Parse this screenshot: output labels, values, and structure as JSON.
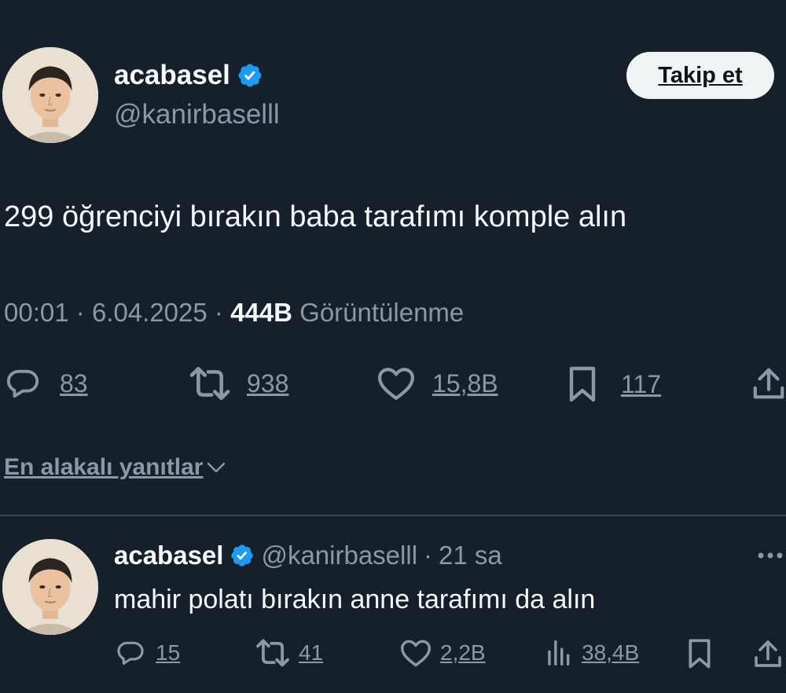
{
  "tweet": {
    "author": {
      "display_name": "acabasel",
      "handle": "@kanirbaselll",
      "verified": true,
      "avatar": "avatar-photo"
    },
    "follow_label": "Takip et",
    "text": "299 öğrenciyi bırakın baba tarafımı komple alın",
    "time": "00:01",
    "date": "6.04.2025",
    "separator": "·",
    "views_count": "444B",
    "views_label": "Görüntülenme",
    "actions": {
      "replies": "83",
      "retweets": "938",
      "likes": "15,8B",
      "bookmarks": "117"
    }
  },
  "sort": {
    "label": "En alakalı yanıtlar"
  },
  "reply": {
    "author": {
      "display_name": "acabasel",
      "handle": "@kanirbaselll",
      "verified": true
    },
    "separator": "·",
    "time": "21 sa",
    "text": "mahir polatı bırakın anne tarafımı da alın",
    "actions": {
      "replies": "15",
      "retweets": "41",
      "likes": "2,2B",
      "views": "38,4B"
    }
  },
  "colors": {
    "background": "#15202b",
    "text_primary": "#f7f9f9",
    "text_secondary": "#8b98a5",
    "verified_blue": "#1d9bf0",
    "button_bg": "#eff3f4"
  },
  "icons": [
    "verified-badge-icon",
    "reply-icon",
    "retweet-icon",
    "like-icon",
    "bookmark-icon",
    "share-icon",
    "views-icon",
    "chevron-down-icon",
    "more-icon"
  ]
}
